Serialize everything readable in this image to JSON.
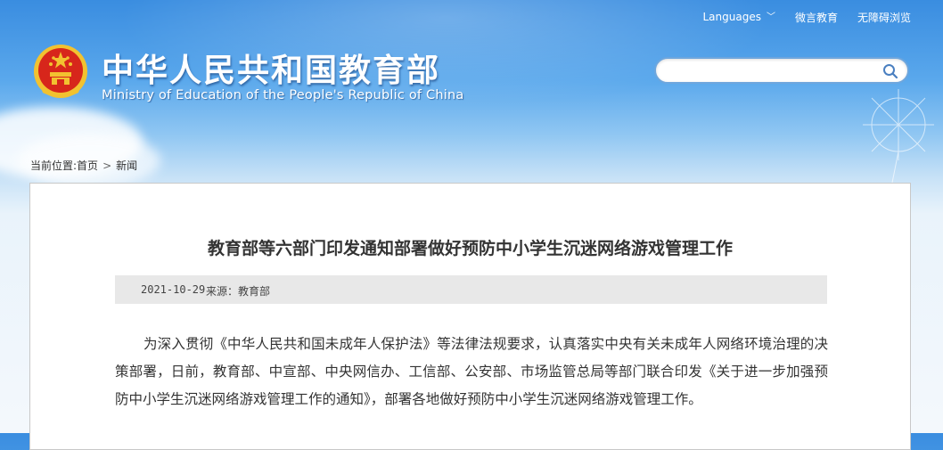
{
  "topnav": {
    "languages_label": "Languages",
    "weibo_label": "微言教育",
    "accessibility_label": "无障碍浏览"
  },
  "header": {
    "title": "中华人民共和国教育部",
    "subtitle": "Ministry of Education of the People's Republic of China"
  },
  "search": {
    "placeholder": ""
  },
  "breadcrumb": {
    "label": "当前位置:",
    "home": "首页",
    "current": "新闻"
  },
  "article": {
    "title": "教育部等六部门印发通知部署做好预防中小学生沉迷网络游戏管理工作",
    "date": "2021-10-29",
    "source": "来源：教育部",
    "paragraph": "为深入贯彻《中华人民共和国未成年人保护法》等法律法规要求，认真落实中央有关未成年人网络环境治理的决策部署，日前，教育部、中宣部、中央网信办、工信部、公安部、市场监管总局等部门联合印发《关于进一步加强预防中小学生沉迷网络游戏管理工作的通知》，部署各地做好预防中小学生沉迷网络游戏管理工作。"
  },
  "colors": {
    "sky_top": "#3a8de0",
    "emblem_red": "#d7261b",
    "emblem_gold": "#f2c230",
    "meta_bg": "#e8e8e8"
  },
  "icons": {
    "search": "search-icon",
    "chevron": "chevron-down-icon",
    "emblem": "national-emblem-icon"
  }
}
